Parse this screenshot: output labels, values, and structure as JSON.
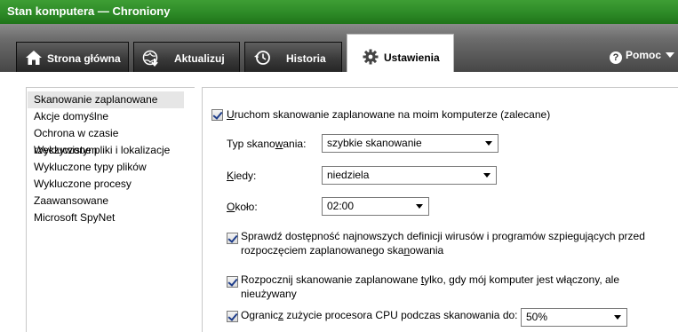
{
  "window": {
    "title": "Stan komputera — Chroniony"
  },
  "tabs": [
    {
      "label": "Strona główna",
      "icon": "home-icon"
    },
    {
      "label": "Aktualizuj",
      "icon": "update-globe-icon"
    },
    {
      "label": "Historia",
      "icon": "history-clock-icon"
    },
    {
      "label": "Ustawienia",
      "icon": "gear-icon",
      "active": true
    }
  ],
  "help": {
    "label": "Pomoc"
  },
  "sidebar": {
    "items": [
      {
        "label": "Skanowanie zaplanowane",
        "selected": true
      },
      {
        "label": "Akcje domyślne"
      },
      {
        "label": "Ochrona w czasie rzeczywistym"
      },
      {
        "label": "Wykluczone pliki i lokalizacje"
      },
      {
        "label": "Wykluczone typy plików"
      },
      {
        "label": "Wykluczone procesy"
      },
      {
        "label": "Zaawansowane"
      },
      {
        "label": "Microsoft SpyNet"
      }
    ]
  },
  "settings": {
    "run_scheduled": {
      "checked": true,
      "u": "U",
      "rest": "ruchom skanowanie zaplanowane na moim komputerze (zalecane)"
    },
    "scan_type": {
      "a": "Typ skano",
      "u": "w",
      "b": "ania:",
      "value": "szybkie skanowanie"
    },
    "when": {
      "u": "K",
      "b": "iedy:",
      "value": "niedziela"
    },
    "time": {
      "u": "O",
      "b": "koło:",
      "value": "02:00"
    },
    "check_defs": {
      "checked": true,
      "line1": "Sprawdź dostępność najnowszych definicji wirusów i programów szpiegujących przed",
      "line2a": "rozpoczęciem zaplanowanego ska",
      "line2u": "n",
      "line2b": "owania"
    },
    "idle_only": {
      "checked": true,
      "line1a": "Rozpocznij skanowanie zaplanowane ",
      "line1u": "t",
      "line1b": "ylko, gdy mój komputer jest włączony, ale",
      "line2": "nieużywany"
    },
    "limit_cpu": {
      "checked": true,
      "a": "Ogranic",
      "u": "z",
      "b": " zużycie procesora CPU podczas skanowania do:",
      "value": "50%"
    }
  }
}
